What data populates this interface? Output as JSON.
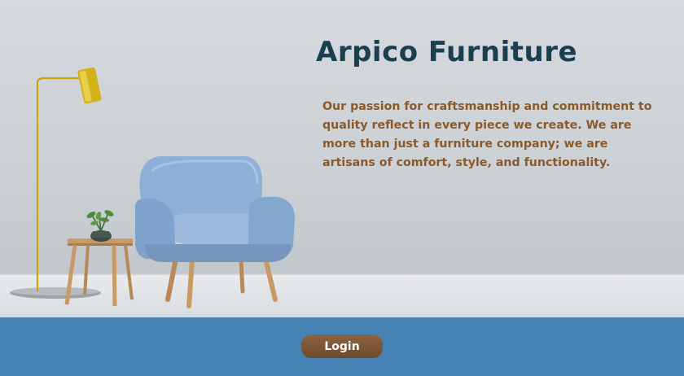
{
  "hero": {
    "title": "Arpico Furniture",
    "description": "Our passion for craftsmanship and commitment to quality reflect in every piece we create. We are more than just a furniture company; we are artisans of comfort, style, and functionality.",
    "illustration": {
      "objects": [
        "floor-lamp",
        "side-table",
        "potted-plant",
        "armchair"
      ],
      "colors": {
        "wall": "#d6dade",
        "armchair": "#8fb0d6",
        "lamp_shade": "#d4b21a",
        "wood": "#c89a66"
      }
    }
  },
  "footer": {
    "background": "#4682b4",
    "login_label": "Login",
    "button_color": "#7a5634"
  },
  "colors": {
    "title": "#1c3f4f",
    "description": "#8b5a2b"
  }
}
